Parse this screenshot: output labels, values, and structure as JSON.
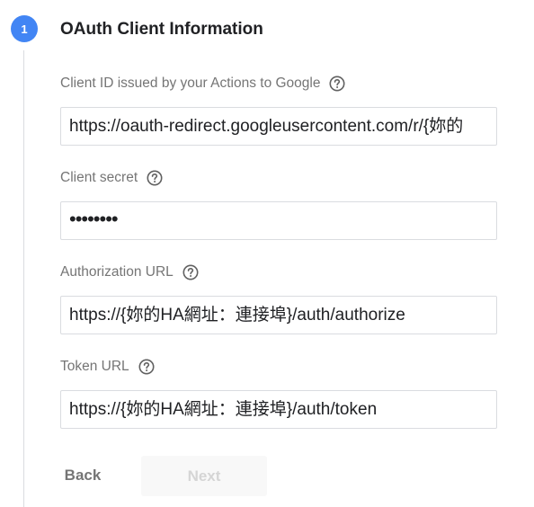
{
  "step": {
    "number": "1",
    "title": "OAuth Client Information",
    "accent_color": "#4285f4"
  },
  "fields": [
    {
      "label": "Client ID issued by your Actions to Google",
      "value": "https://oauth-redirect.googleusercontent.com/r/{妳的",
      "help_icon": "help-circle-icon"
    },
    {
      "label": "Client secret",
      "value": "••••••••",
      "help_icon": "help-circle-icon"
    },
    {
      "label": "Authorization URL",
      "value": "https://{妳的HA網址：連接埠}/auth/authorize",
      "help_icon": "help-circle-icon"
    },
    {
      "label": "Token URL",
      "value": "https://{妳的HA網址：連接埠}/auth/token",
      "help_icon": "help-circle-icon"
    }
  ],
  "buttons": {
    "back_label": "Back",
    "next_label": "Next"
  }
}
